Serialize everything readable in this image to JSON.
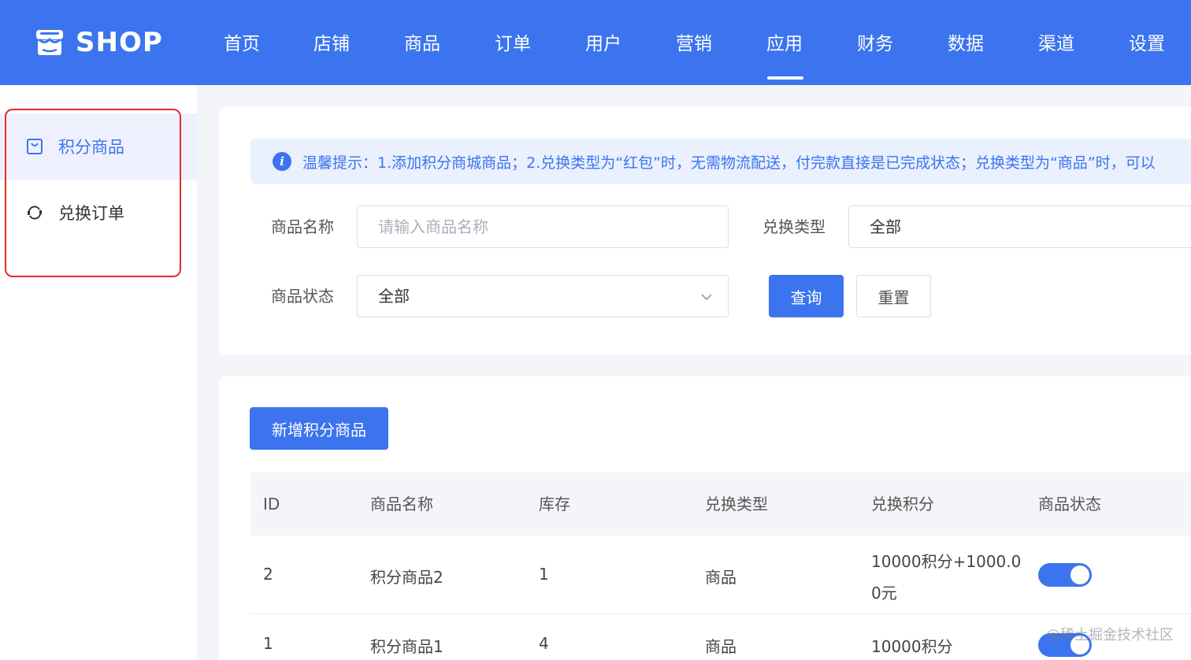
{
  "brand": {
    "name": "SHOP"
  },
  "nav": {
    "items": [
      "首页",
      "店铺",
      "商品",
      "订单",
      "用户",
      "营销",
      "应用",
      "财务",
      "数据",
      "渠道",
      "设置"
    ],
    "active_index": 6
  },
  "sidebar": {
    "items": [
      {
        "label": "积分商品",
        "icon": "bag-icon",
        "active": true
      },
      {
        "label": "兑换订单",
        "icon": "exchange-icon",
        "active": false
      }
    ]
  },
  "tip": {
    "text": "温馨提示：1.添加积分商城商品；2.兑换类型为“红包”时，无需物流配送，付完款直接是已完成状态；兑换类型为“商品”时，可以"
  },
  "filters": {
    "product_name_label": "商品名称",
    "product_name_placeholder": "请输入商品名称",
    "exchange_type_label": "兑换类型",
    "exchange_type_value": "全部",
    "status_label": "商品状态",
    "status_value": "全部",
    "query_button": "查询",
    "reset_button": "重置"
  },
  "actions": {
    "add_button": "新增积分商品"
  },
  "table": {
    "columns": [
      "ID",
      "商品名称",
      "库存",
      "兑换类型",
      "兑换积分",
      "商品状态"
    ],
    "rows": [
      {
        "id": "2",
        "name": "积分商品2",
        "stock": "1",
        "type": "商品",
        "points_line1": "10000积分+1000.0",
        "points_line2": "0元",
        "status_on": true
      },
      {
        "id": "1",
        "name": "积分商品1",
        "stock": "4",
        "type": "商品",
        "points_line1": "10000积分",
        "points_line2": "",
        "status_on": true
      }
    ]
  },
  "watermark": "@稀土掘金技术社区",
  "colors": {
    "primary": "#3b74ee",
    "highlight_border": "#e02c2c"
  }
}
